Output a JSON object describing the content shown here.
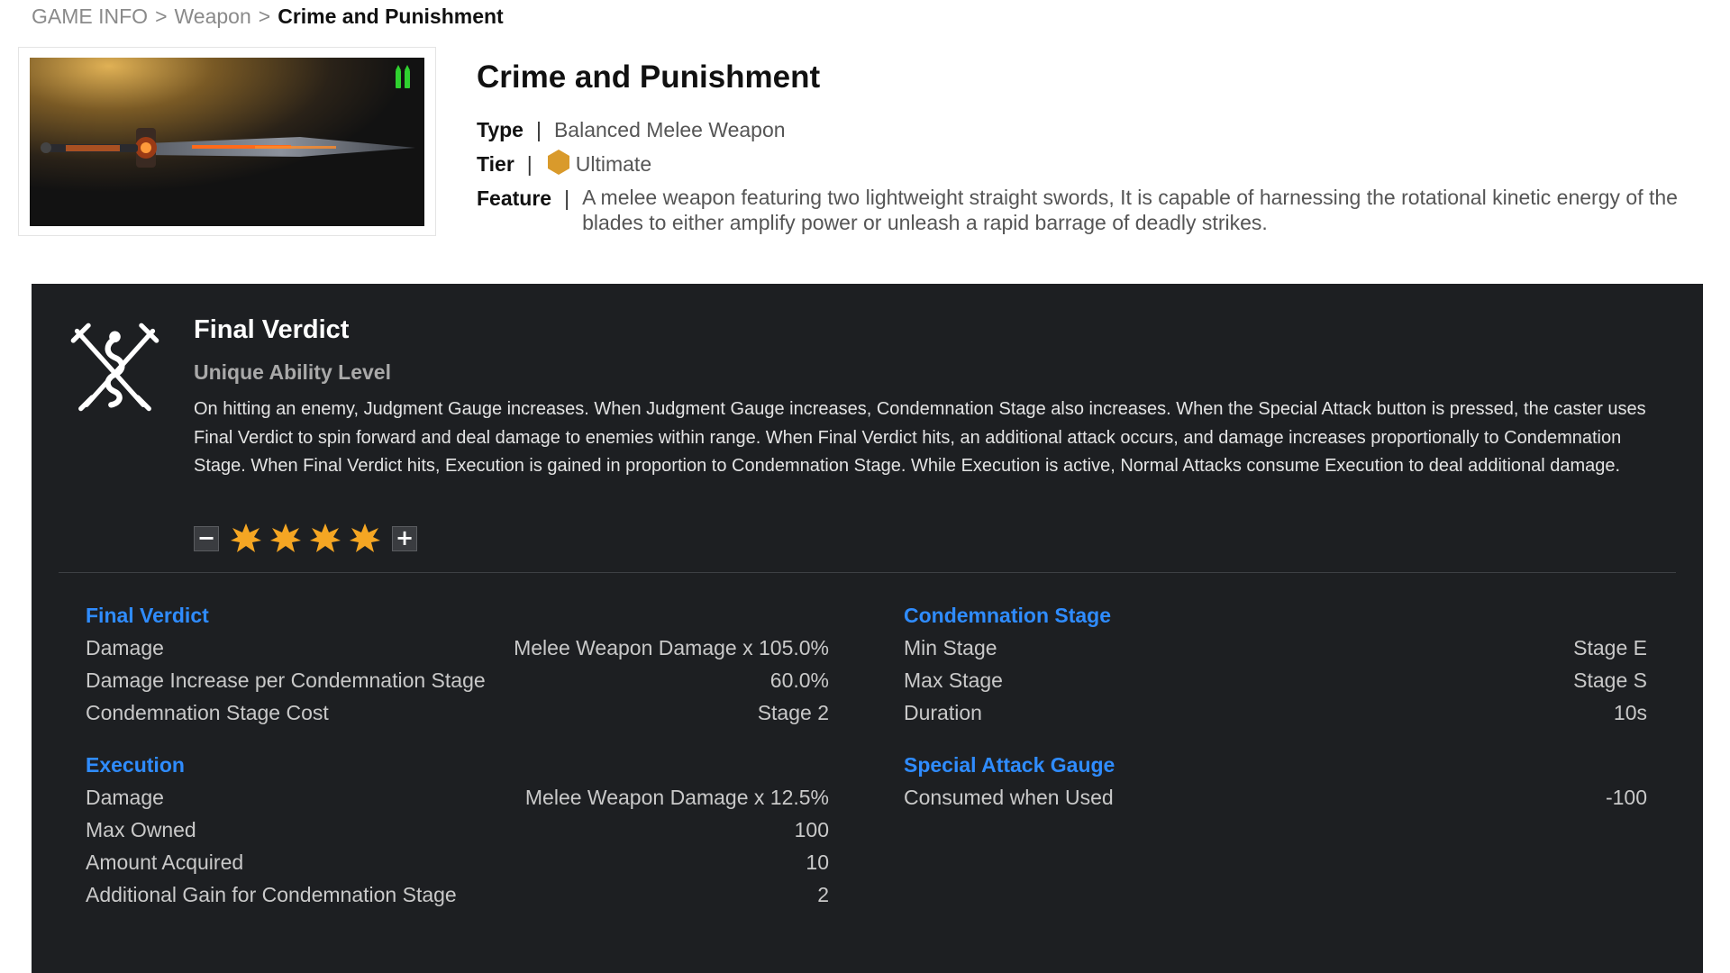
{
  "breadcrumb": {
    "items": [
      "GAME INFO",
      "Weapon"
    ],
    "separator": ">",
    "current": "Crime and Punishment"
  },
  "weapon": {
    "name": "Crime and Punishment",
    "type_label": "Type",
    "type_value": "Balanced Melee Weapon",
    "tier_label": "Tier",
    "tier_value": "Ultimate",
    "tier_icon": "hexagon-icon",
    "tier_color": "#d99a2b",
    "feature_label": "Feature",
    "feature_value": "A melee weapon featuring two lightweight straight swords, It is capable of harnessing the rotational kinetic energy of the blades to either amplify power or unleash a rapid barrage of deadly strikes.",
    "divider": "|",
    "image_icon": "sword-icon",
    "ammo_icon": "ammo-icon",
    "ammo_color": "#2fd12f"
  },
  "ability": {
    "name": "Final Verdict",
    "subtitle": "Unique Ability Level",
    "icon": "crossed-swords-icon",
    "description": "On hitting an enemy, Judgment Gauge increases. When Judgment Gauge increases, Condemnation Stage also increases. When the Special Attack button is pressed, the caster uses Final Verdict to spin forward and deal damage to enemies within range. When Final Verdict hits, an additional attack occurs, and damage increases proportionally to Condemnation Stage. When Final Verdict hits, Execution is gained in proportion to Condemnation Stage. While Execution is active, Normal Attacks consume Execution to deal additional damage.",
    "level": 4,
    "level_max": 4,
    "star_color": "#f5a623",
    "minus_label": "−",
    "plus_label": "+"
  },
  "stats": {
    "accent_color": "#2f8cff",
    "final_verdict": {
      "title": "Final Verdict",
      "rows": [
        {
          "label": "Damage",
          "value": "Melee Weapon Damage x 105.0%"
        },
        {
          "label": "Damage Increase per Condemnation Stage",
          "value": "60.0%"
        },
        {
          "label": "Condemnation Stage Cost",
          "value": "Stage 2"
        }
      ]
    },
    "execution": {
      "title": "Execution",
      "rows": [
        {
          "label": "Damage",
          "value": "Melee Weapon Damage x 12.5%"
        },
        {
          "label": "Max Owned",
          "value": "100"
        },
        {
          "label": "Amount Acquired",
          "value": "10"
        },
        {
          "label": "Additional Gain for Condemnation Stage",
          "value": "2"
        }
      ]
    },
    "condemnation_stage": {
      "title": "Condemnation Stage",
      "rows": [
        {
          "label": "Min Stage",
          "value": "Stage E"
        },
        {
          "label": "Max Stage",
          "value": "Stage S"
        },
        {
          "label": "Duration",
          "value": "10s"
        }
      ]
    },
    "special_attack_gauge": {
      "title": "Special Attack Gauge",
      "rows": [
        {
          "label": "Consumed when Used",
          "value": "-100"
        }
      ]
    }
  }
}
